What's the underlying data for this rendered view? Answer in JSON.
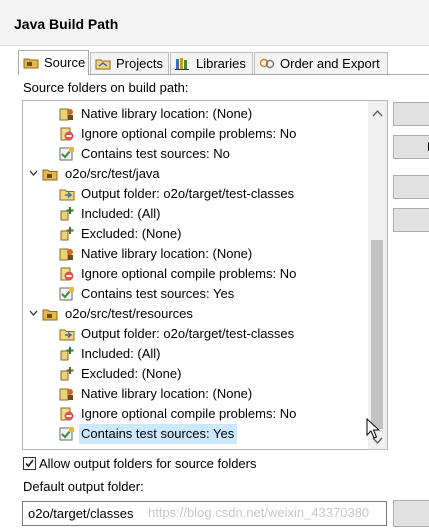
{
  "window": {
    "title": "Java Build Path"
  },
  "tabs": [
    {
      "label": "Source",
      "icon": "source-tab-icon",
      "active": true
    },
    {
      "label": "Projects",
      "icon": "projects-tab-icon",
      "active": false
    },
    {
      "label": "Libraries",
      "icon": "libraries-tab-icon",
      "active": false
    },
    {
      "label": "Order and Export",
      "icon": "order-export-tab-icon",
      "active": false
    }
  ],
  "source_section": {
    "label": "Source folders on build path:"
  },
  "tree": {
    "rows": [
      {
        "label": "Native library location: (None)",
        "icon": "native-library-icon"
      },
      {
        "label": "Ignore optional compile problems: No",
        "icon": "ignore-problems-icon"
      },
      {
        "label": "Contains test sources: No",
        "icon": "test-sources-icon"
      },
      {
        "label": "o2o/src/test/java",
        "icon": "source-folder-icon",
        "expanded": true
      },
      {
        "label": "Output folder: o2o/target/test-classes",
        "icon": "output-folder-icon"
      },
      {
        "label": "Included: (All)",
        "icon": "included-icon"
      },
      {
        "label": "Excluded: (None)",
        "icon": "excluded-icon"
      },
      {
        "label": "Native library location: (None)",
        "icon": "native-library-icon"
      },
      {
        "label": "Ignore optional compile problems: No",
        "icon": "ignore-problems-icon"
      },
      {
        "label": "Contains test sources: Yes",
        "icon": "test-sources-icon"
      },
      {
        "label": "o2o/src/test/resources",
        "icon": "source-folder-icon",
        "expanded": true
      },
      {
        "label": "Output folder: o2o/target/test-classes",
        "icon": "output-folder-icon"
      },
      {
        "label": "Included: (All)",
        "icon": "included-icon"
      },
      {
        "label": "Excluded: (None)",
        "icon": "excluded-icon"
      },
      {
        "label": "Native library location: (None)",
        "icon": "native-library-icon"
      },
      {
        "label": "Ignore optional compile problems: No",
        "icon": "ignore-problems-icon"
      },
      {
        "label": "Contains test sources: Yes",
        "icon": "test-sources-icon",
        "selected": true
      }
    ]
  },
  "side_buttons": [
    {
      "label": ""
    },
    {
      "label": "L"
    },
    {
      "label": ""
    },
    {
      "label": ""
    }
  ],
  "options": {
    "allow_output_folders": {
      "label": "Allow output folders for source folders",
      "checked": true
    },
    "default_output_label": "Default output folder:",
    "default_output_value": "o2o/target/classes"
  },
  "watermark": "https://blog.csdn.net/weixin_43370380",
  "colors": {
    "selection": "#cce8ff",
    "title_bar": "#f3f3f3",
    "folder": "#e6b84a",
    "package": "#6b4a1f"
  }
}
